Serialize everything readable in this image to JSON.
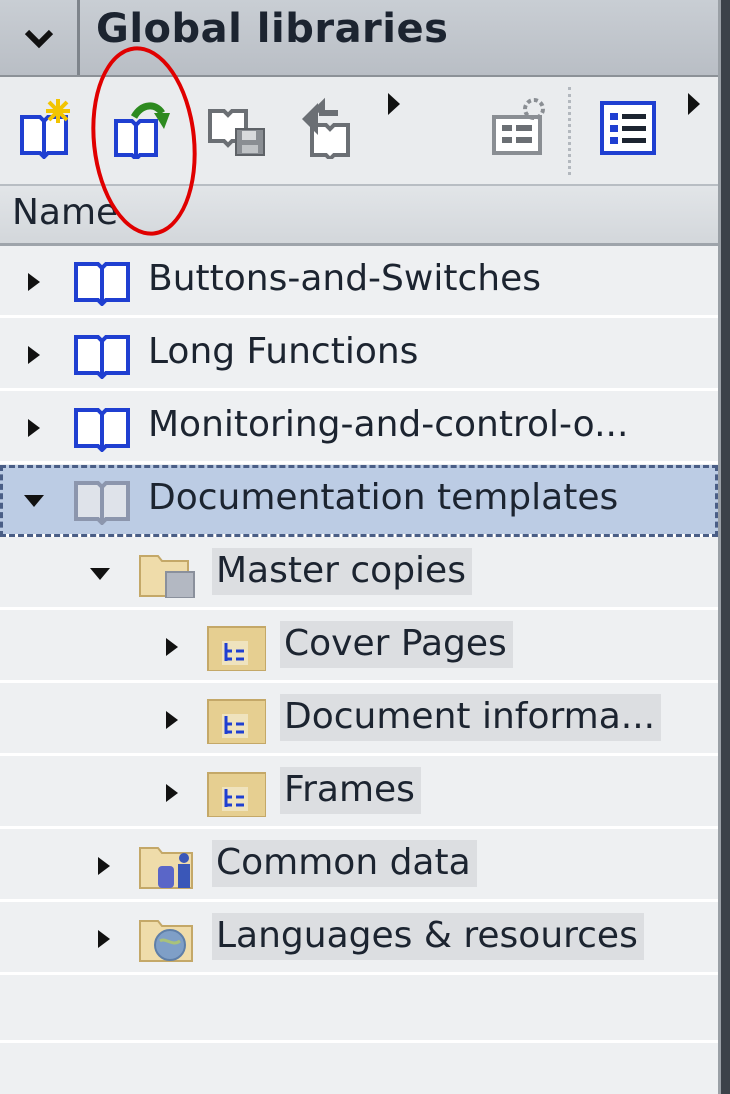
{
  "header": {
    "collapse_icon": "chevron-down-icon",
    "title": "Global libraries"
  },
  "toolbar": {
    "buttons": [
      {
        "name": "create-new-library-button",
        "icon": "book-new-star-icon"
      },
      {
        "name": "open-library-button",
        "icon": "book-open-arrow-icon"
      },
      {
        "name": "save-library-button",
        "icon": "library-save-icon"
      },
      {
        "name": "close-library-button",
        "icon": "library-close-icon"
      },
      {
        "name": "library-properties-button",
        "icon": "library-properties-icon"
      },
      {
        "name": "library-view-button",
        "icon": "list-view-icon"
      }
    ]
  },
  "columns": {
    "name": "Name"
  },
  "tree": {
    "rows": [
      {
        "label": "Buttons-and-Switches",
        "expanded": false,
        "icon": "library-book-icon"
      },
      {
        "label": "Long Functions",
        "expanded": false,
        "icon": "library-book-icon"
      },
      {
        "label": "Monitoring-and-control-o...",
        "expanded": false,
        "icon": "library-book-icon"
      },
      {
        "label": "Documentation templates",
        "expanded": true,
        "icon": "library-book-icon",
        "selected": true
      },
      {
        "label": "Master copies",
        "expanded": true,
        "icon": "master-copies-folder-icon"
      },
      {
        "label": "Cover Pages",
        "expanded": false,
        "icon": "folder-icon"
      },
      {
        "label": "Document informa...",
        "expanded": false,
        "icon": "folder-icon"
      },
      {
        "label": "Frames",
        "expanded": false,
        "icon": "folder-icon"
      },
      {
        "label": "Common data",
        "expanded": false,
        "icon": "common-data-folder-icon"
      },
      {
        "label": "Languages & resources",
        "expanded": false,
        "icon": "languages-folder-icon"
      }
    ]
  },
  "colors": {
    "selection": "#bccce4",
    "annotation": "#e00000",
    "book_blue": "#1f3fd1",
    "folder_tan": "#e8cf8c"
  }
}
